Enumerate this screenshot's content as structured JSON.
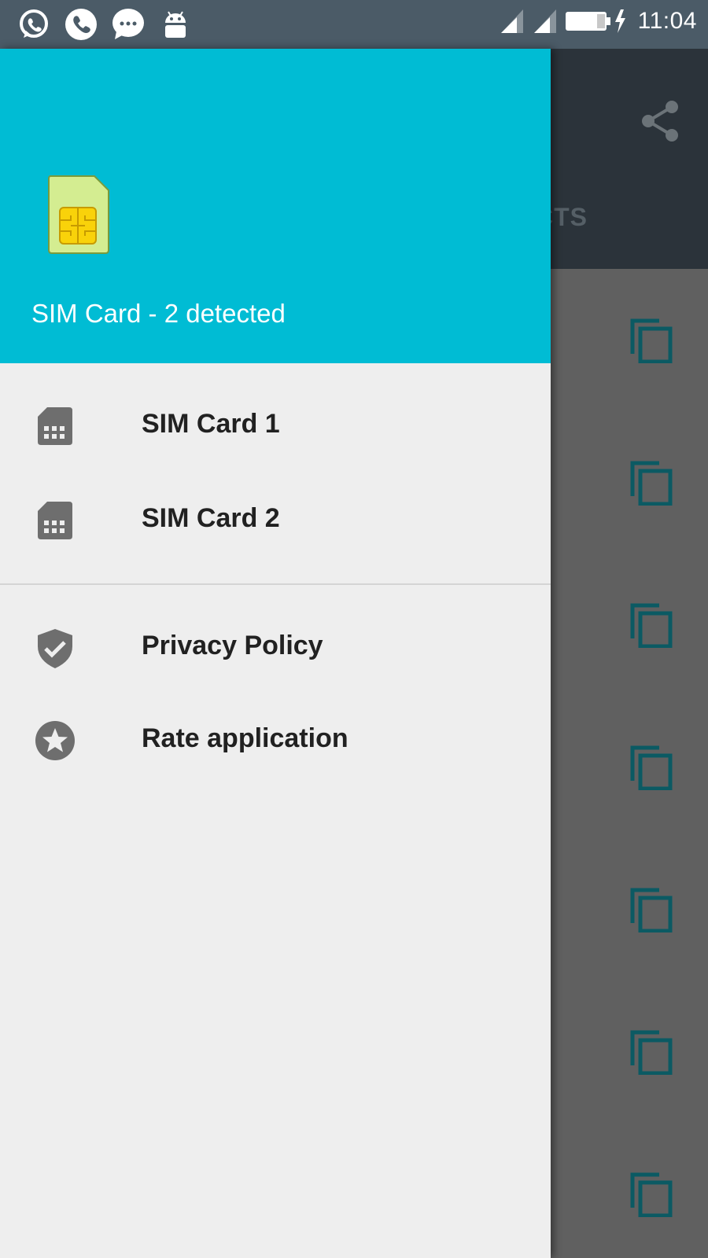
{
  "status_bar": {
    "time": "11:04",
    "left_icons": [
      "whatsapp-icon",
      "phone-icon",
      "messages-icon",
      "android-icon"
    ],
    "right_icons": [
      "signal-icon",
      "signal-icon",
      "battery-charging-icon"
    ]
  },
  "background_app": {
    "tab_partial": "CTS",
    "toolbar_icon": "share-icon",
    "row_icon": "copy-icon"
  },
  "drawer": {
    "header_title": "SIM Card - 2 detected",
    "header_icon": "sim-card-chip-icon",
    "header_color": "#00bcd4",
    "items": [
      {
        "label": "SIM Card 1",
        "icon": "sim-card-icon"
      },
      {
        "label": "SIM Card 2",
        "icon": "sim-card-icon"
      },
      {
        "label": "Privacy Policy",
        "icon": "shield-check-icon"
      },
      {
        "label": "Rate application",
        "icon": "star-circle-icon"
      }
    ]
  }
}
